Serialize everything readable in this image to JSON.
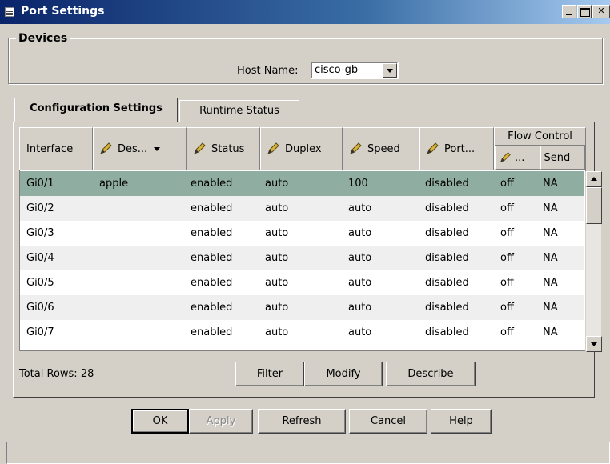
{
  "window": {
    "title": "Port Settings"
  },
  "devices": {
    "legend": "Devices",
    "host_label": "Host Name:",
    "host_value": "cisco-gb"
  },
  "tabs": [
    {
      "label": "Configuration Settings",
      "active": true
    },
    {
      "label": "Runtime Status",
      "active": false
    }
  ],
  "table": {
    "headers": {
      "interface": "Interface",
      "description": "Des...",
      "status": "Status",
      "duplex": "Duplex",
      "speed": "Speed",
      "port": "Port...",
      "flow_control": "Flow Control",
      "flow_receive": "...",
      "flow_send": "Send"
    },
    "rows": [
      [
        "Gi0/1",
        "apple",
        "enabled",
        "auto",
        "100",
        "disabled",
        "off",
        "NA"
      ],
      [
        "Gi0/2",
        "",
        "enabled",
        "auto",
        "auto",
        "disabled",
        "off",
        "NA"
      ],
      [
        "Gi0/3",
        "",
        "enabled",
        "auto",
        "auto",
        "disabled",
        "off",
        "NA"
      ],
      [
        "Gi0/4",
        "",
        "enabled",
        "auto",
        "auto",
        "disabled",
        "off",
        "NA"
      ],
      [
        "Gi0/5",
        "",
        "enabled",
        "auto",
        "auto",
        "disabled",
        "off",
        "NA"
      ],
      [
        "Gi0/6",
        "",
        "enabled",
        "auto",
        "auto",
        "disabled",
        "off",
        "NA"
      ],
      [
        "Gi0/7",
        "",
        "enabled",
        "auto",
        "auto",
        "disabled",
        "off",
        "NA"
      ]
    ],
    "selected_row_index": 0,
    "total_rows": "Total Rows: 28"
  },
  "table_buttons": {
    "filter": "Filter",
    "modify": "Modify",
    "describe": "Describe"
  },
  "dialog_buttons": {
    "ok": "OK",
    "apply": "Apply",
    "refresh": "Refresh",
    "cancel": "Cancel",
    "help": "Help"
  },
  "icons": {
    "app": "window-icon",
    "minimize": "minimize-icon",
    "maximize": "maximize-icon",
    "close": "close-icon",
    "edit": "pencil-icon",
    "sort": "sort-down-icon"
  },
  "colors": {
    "title_bar": "#0a246a",
    "selected_row": "#8fada0",
    "face": "#d4d0c8"
  }
}
